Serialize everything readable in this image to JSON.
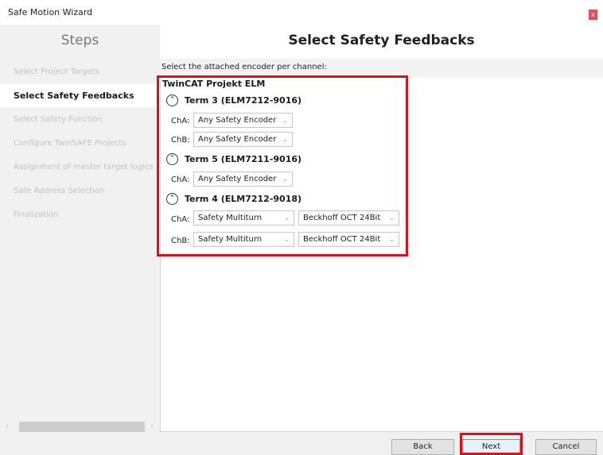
{
  "window": {
    "title": "Safe Motion Wizard",
    "close_glyph": "x"
  },
  "sidebar": {
    "title": "Steps",
    "items": [
      {
        "label": "Select Project Targets",
        "active": false
      },
      {
        "label": "Select Safety Feedbacks",
        "active": true
      },
      {
        "label": "Select Safety Function",
        "active": false
      },
      {
        "label": "Configure TwinSAFE Projects",
        "active": false
      },
      {
        "label": "Assignment of master target logics",
        "active": false
      },
      {
        "label": "Safe Address Selection",
        "active": false
      },
      {
        "label": "Finalization",
        "active": false
      }
    ]
  },
  "main": {
    "title": "Select Safety Feedbacks",
    "instruction": "Select the attached encoder per channel:",
    "project": "TwinCAT Projekt ELM",
    "terms": [
      {
        "label": "Term 3 (ELM7212-9016)",
        "channels": [
          {
            "name": "ChA:",
            "encoder": "Any Safety Encoder"
          },
          {
            "name": "ChB:",
            "encoder": "Any Safety Encoder"
          }
        ]
      },
      {
        "label": "Term 5 (ELM7211-9016)",
        "channels": [
          {
            "name": "ChA:",
            "encoder": "Any Safety Encoder"
          }
        ]
      },
      {
        "label": "Term 4 (ELM7212-9018)",
        "channels": [
          {
            "name": "ChA:",
            "encoder": "Safety Multiturn",
            "type": "Beckhoff OCT 24Bit"
          },
          {
            "name": "ChB:",
            "encoder": "Safety Multiturn",
            "type": "Beckhoff OCT 24Bit"
          }
        ]
      }
    ]
  },
  "footer": {
    "back": "Back",
    "next": "Next",
    "cancel": "Cancel"
  },
  "colors": {
    "highlight": "#d5131f",
    "sidebar_bg": "#f1f1f1",
    "active_step_bg": "#ffffff"
  },
  "icons": {
    "caret": "chevron-up-icon",
    "dropdown": "chevron-down-icon"
  }
}
